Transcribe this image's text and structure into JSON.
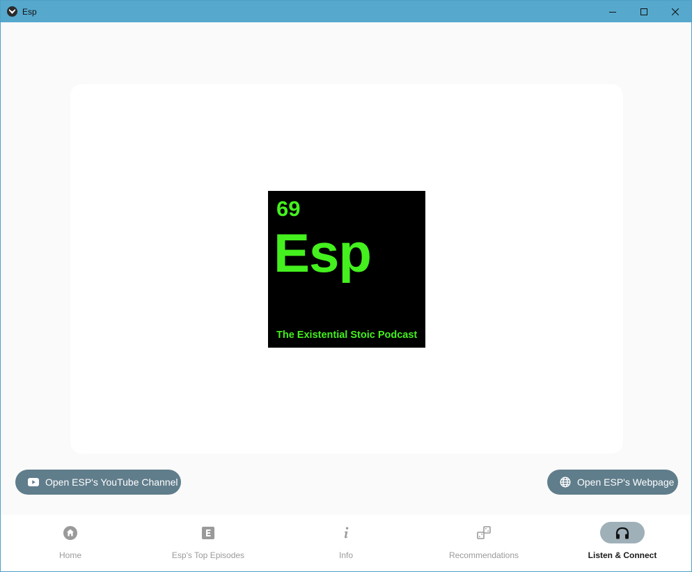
{
  "window": {
    "title": "Esp"
  },
  "logo": {
    "number": "69",
    "symbol": "Esp",
    "subtitle": "The Existential Stoic Podcast",
    "text_color": "#44f01d"
  },
  "actions": {
    "youtube_label": "Open ESP's YouTube Channel",
    "web_label": "Open ESP's Webpage"
  },
  "nav": {
    "items": [
      {
        "label": "Home",
        "icon": "home-icon"
      },
      {
        "label": "Esp's Top Episodes",
        "icon": "letter-e-icon"
      },
      {
        "label": "Info",
        "icon": "info-icon"
      },
      {
        "label": "Recommendations",
        "icon": "dice-icon"
      },
      {
        "label": "Listen & Connect",
        "icon": "headphones-icon"
      }
    ],
    "active": "Listen & Connect"
  },
  "colors": {
    "titlebar": "#56a8cd",
    "button": "#607d8b",
    "active_indicator": "#9fb0b9"
  }
}
